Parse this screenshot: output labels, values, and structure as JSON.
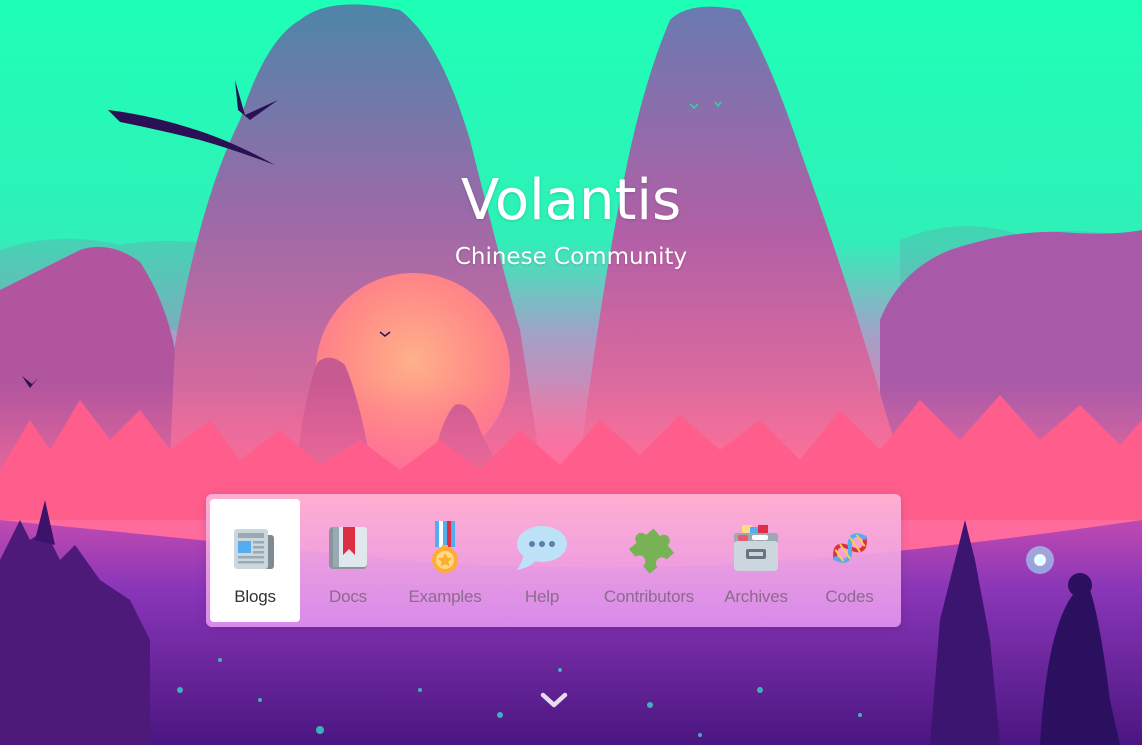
{
  "hero": {
    "title": "Volantis",
    "subtitle": "Chinese Community"
  },
  "nav": {
    "active_index": 0,
    "items": [
      {
        "label": "Blogs",
        "icon": "newspaper-icon"
      },
      {
        "label": "Docs",
        "icon": "book-icon"
      },
      {
        "label": "Examples",
        "icon": "medal-icon"
      },
      {
        "label": "Help",
        "icon": "speech-bubble-icon"
      },
      {
        "label": "Contributors",
        "icon": "puzzle-piece-icon"
      },
      {
        "label": "Archives",
        "icon": "card-file-box-icon"
      },
      {
        "label": "Codes",
        "icon": "dna-icon"
      }
    ]
  },
  "scroll": {
    "icon": "chevron-down-icon"
  },
  "colors": {
    "sky": "#1effb6",
    "mountain": "#8a62b0",
    "sun": "#ff8d86",
    "foreground": "#5a1c8c",
    "nav_bg_top": "#ffb6d6",
    "nav_bg_bottom": "#e092f0"
  }
}
